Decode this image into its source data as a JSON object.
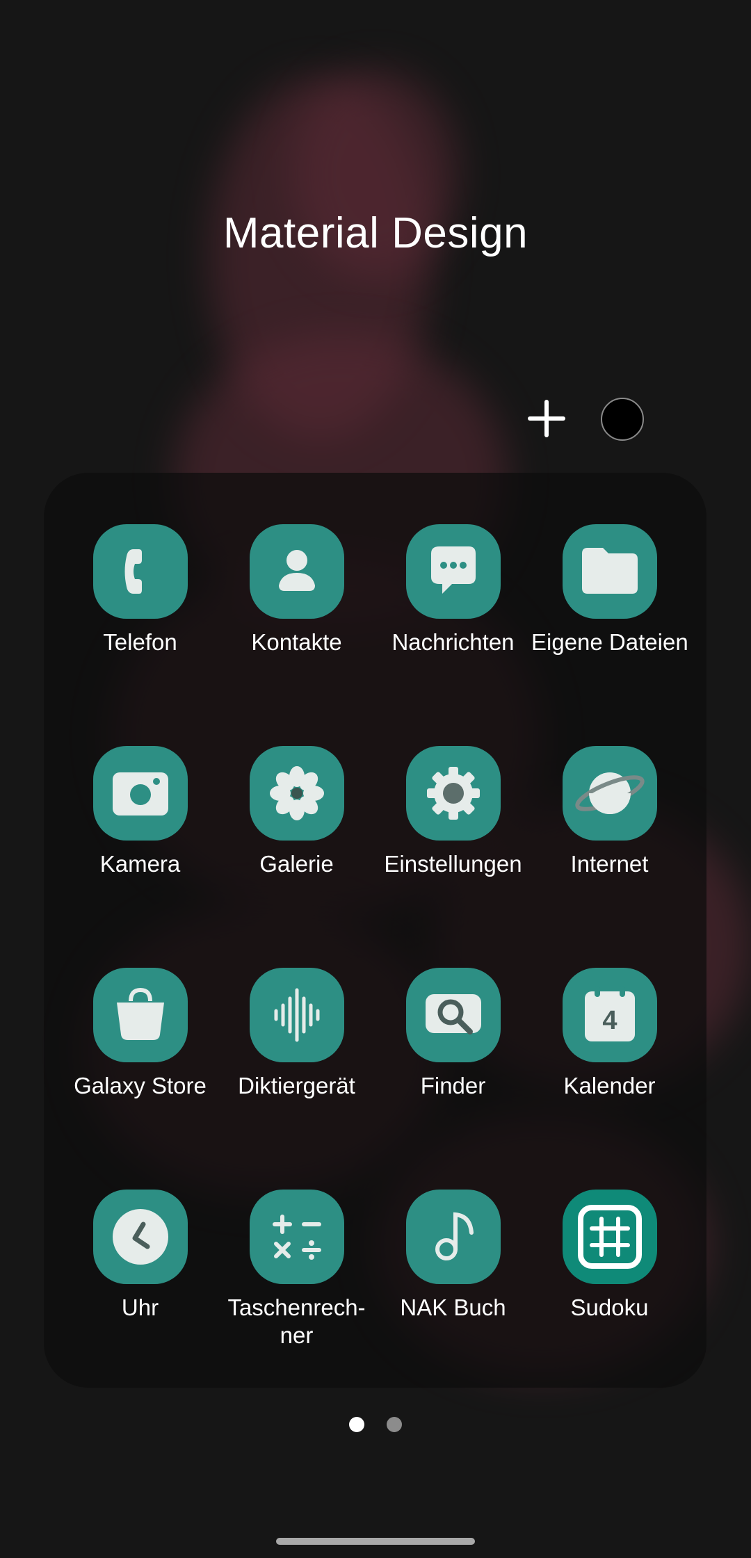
{
  "folder": {
    "title": "Material Design"
  },
  "folder_controls": {
    "add_icon": "plus-icon",
    "color_icon": "color-circle-icon"
  },
  "colors": {
    "icon_bg": "#2d8f84",
    "icon_glyph": "#e6ecea",
    "sudoku_bg": "#0f8a78",
    "background": "#161616",
    "active_dot": "#ffffff",
    "inactive_dot": "#8c8c8c"
  },
  "apps": [
    {
      "label": "Telefon",
      "icon": "phone-icon"
    },
    {
      "label": "Kontakte",
      "icon": "contact-icon"
    },
    {
      "label": "Nachrichten",
      "icon": "message-icon"
    },
    {
      "label": "Eigene Dateien",
      "icon": "folder-icon"
    },
    {
      "label": "Kamera",
      "icon": "camera-icon"
    },
    {
      "label": "Galerie",
      "icon": "flower-icon"
    },
    {
      "label": "Einstellungen",
      "icon": "gear-icon"
    },
    {
      "label": "Internet",
      "icon": "planet-icon"
    },
    {
      "label": "Galaxy Store",
      "icon": "shopping-bag-icon"
    },
    {
      "label": "Diktiergerät",
      "icon": "waveform-icon"
    },
    {
      "label": "Finder",
      "icon": "magnifier-icon"
    },
    {
      "label": "Kalender",
      "icon": "calendar-icon",
      "badge": "4"
    },
    {
      "label": "Uhr",
      "icon": "clock-icon"
    },
    {
      "label": "Taschenrech-",
      "label_line2": "ner",
      "icon": "calculator-icon"
    },
    {
      "label": "NAK Buch",
      "icon": "music-note-icon"
    },
    {
      "label": "Sudoku",
      "icon": "grid-icon"
    }
  ],
  "pagination": {
    "pages": 2,
    "current": 1
  }
}
